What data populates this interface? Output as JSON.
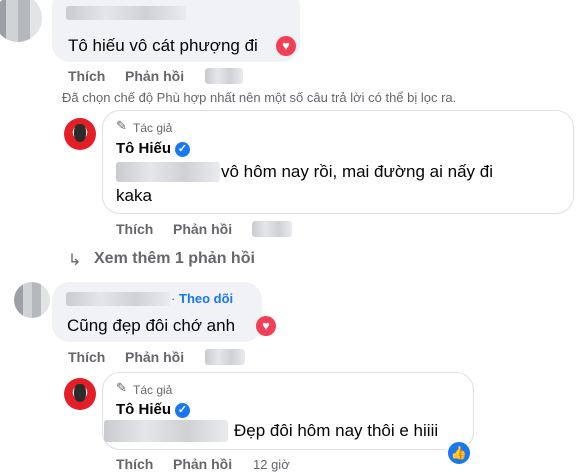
{
  "comment1": {
    "text": "Tô hiếu vô cát phượng đi",
    "actions": {
      "like": "Thích",
      "reply": "Phản hồi"
    }
  },
  "filter_notice": "Đã chọn chế độ Phù hợp nhất nên một số câu trả lời có thể bị lọc ra.",
  "reply1": {
    "author_badge": "Tác giả",
    "author_name": "Tô Hiếu",
    "text_line1": "vô hôm nay rồi, mai đường ai nấy đi",
    "text_line2": "kaka",
    "actions": {
      "like": "Thích",
      "reply": "Phản hồi"
    }
  },
  "see_more": "Xem thêm 1 phản hồi",
  "comment2": {
    "follow": "Theo dõi",
    "text": "Cũng đẹp đôi chớ anh",
    "actions": {
      "like": "Thích",
      "reply": "Phản hồi"
    }
  },
  "reply2": {
    "author_badge": "Tác giả",
    "author_name": "Tô Hiếu",
    "text": "Đẹp đôi hôm nay thôi e hiiii",
    "actions": {
      "like": "Thích",
      "reply": "Phản hồi",
      "time": "12 giờ"
    }
  },
  "icons": {
    "heart": "heart-reaction-icon",
    "verified": "verified-badge-icon",
    "pencil": "pencil-icon",
    "reply_arrow": "reply-arrow-icon",
    "like": "like-thumb-icon"
  },
  "colors": {
    "brand_blue": "#1877f2",
    "heart_red": "#f33e58",
    "muted": "#65676b",
    "bubble": "#f0f2f5"
  }
}
